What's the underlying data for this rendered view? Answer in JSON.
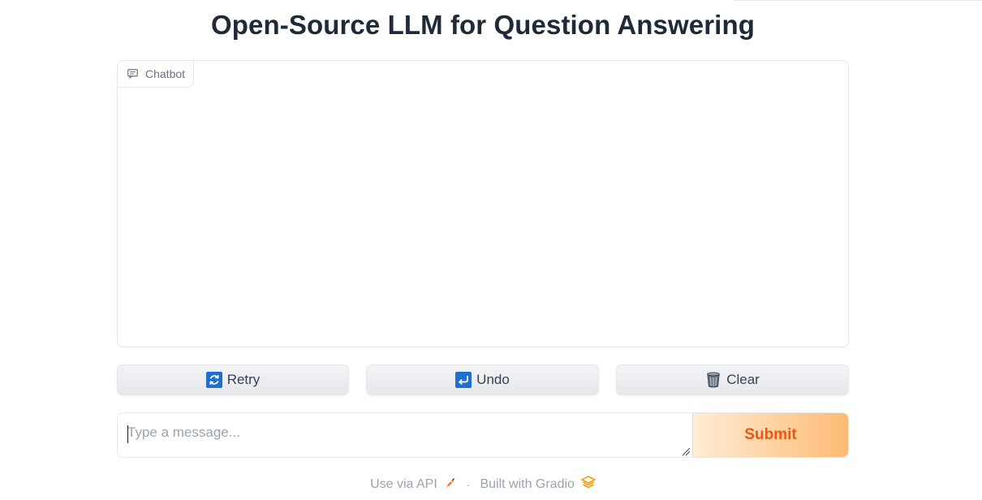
{
  "title": "Open-Source LLM for Question Answering",
  "chatbot": {
    "label": "Chatbot",
    "icon": "chat-icon"
  },
  "buttons": {
    "retry": {
      "label": "Retry",
      "icon": "retry-icon"
    },
    "undo": {
      "label": "Undo",
      "icon": "undo-icon"
    },
    "clear": {
      "label": "Clear",
      "icon": "trash-icon"
    }
  },
  "input": {
    "placeholder": "Type a message...",
    "value": ""
  },
  "submit": {
    "label": "Submit"
  },
  "footer": {
    "api_label": "Use via API",
    "separator": "·",
    "built_label": "Built with Gradio"
  },
  "colors": {
    "accent": "#ea580c",
    "submit_gradient_start": "#ffedd5",
    "submit_gradient_end": "#fdba74",
    "emoji_blue": "#1e6fd0"
  }
}
